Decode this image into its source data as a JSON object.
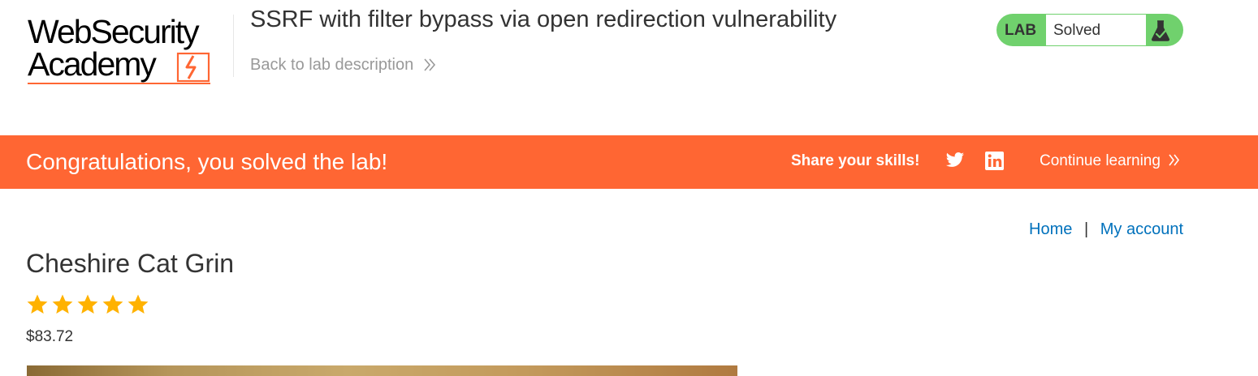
{
  "logo": {
    "line1": "WebSecurity",
    "line2": "Academy"
  },
  "lab": {
    "title": "SSRF with filter bypass via open redirection vulnerability",
    "back_link": "Back to lab description",
    "tag": "LAB",
    "status": "Solved"
  },
  "banner": {
    "message": "Congratulations, you solved the lab!",
    "share": "Share your skills!",
    "continue": "Continue learning"
  },
  "nav": {
    "home": "Home",
    "separator": "|",
    "account": "My account"
  },
  "product": {
    "name": "Cheshire Cat Grin",
    "rating": 5,
    "rating_max": 5,
    "price": "$83.72"
  },
  "colors": {
    "accent": "#ff6633",
    "solved": "#70d16d",
    "link": "#0071bc",
    "star": "#ffb200"
  },
  "icons": {
    "twitter": "twitter-icon",
    "linkedin": "linkedin-icon",
    "flask": "flask-icon",
    "chevron": "double-chevron-right-icon",
    "star": "star-icon"
  }
}
